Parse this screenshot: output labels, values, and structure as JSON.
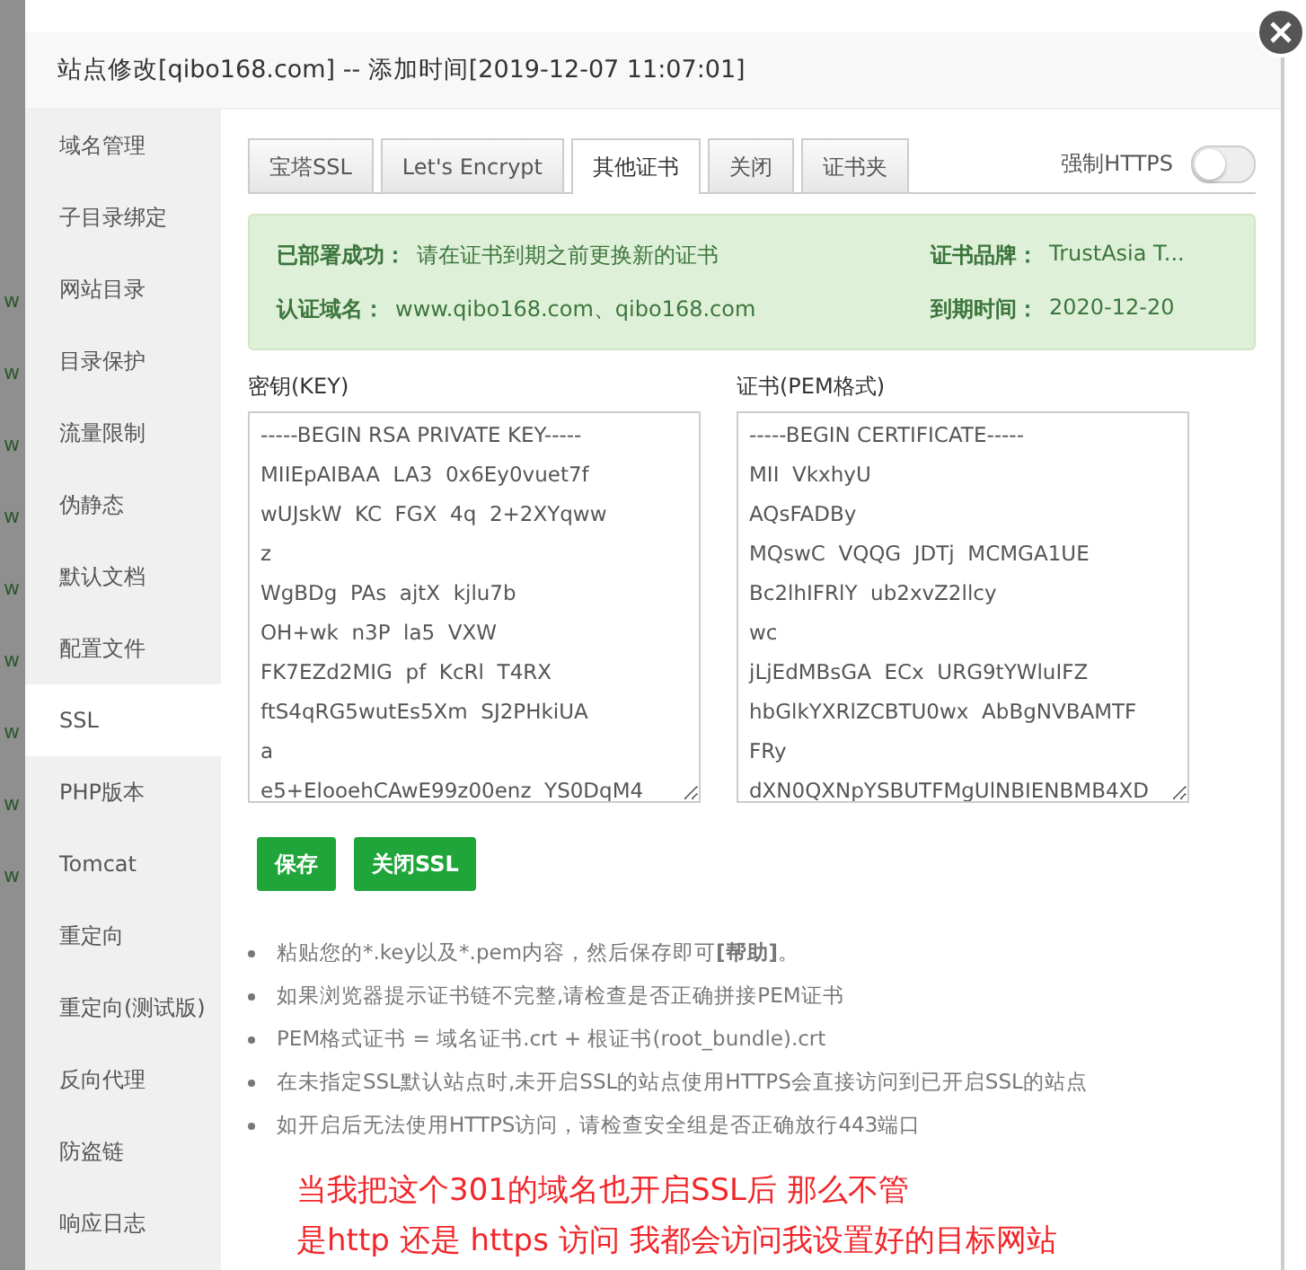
{
  "background_rows": [
    "w",
    "w",
    "w",
    "w",
    "w",
    "w",
    "w",
    "w",
    "w"
  ],
  "dialog": {
    "title": "站点修改[qibo168.com] -- 添加时间[2019-12-07 11:07:01]"
  },
  "sidebar": {
    "items": [
      {
        "label": "域名管理",
        "selected": false
      },
      {
        "label": "子目录绑定",
        "selected": false
      },
      {
        "label": "网站目录",
        "selected": false
      },
      {
        "label": "目录保护",
        "selected": false
      },
      {
        "label": "流量限制",
        "selected": false
      },
      {
        "label": "伪静态",
        "selected": false
      },
      {
        "label": "默认文档",
        "selected": false
      },
      {
        "label": "配置文件",
        "selected": false
      },
      {
        "label": "SSL",
        "selected": true
      },
      {
        "label": "PHP版本",
        "selected": false
      },
      {
        "label": "Tomcat",
        "selected": false
      },
      {
        "label": "重定向",
        "selected": false
      },
      {
        "label": "重定向(测试版)",
        "selected": false
      },
      {
        "label": "反向代理",
        "selected": false
      },
      {
        "label": "防盗链",
        "selected": false
      },
      {
        "label": "响应日志",
        "selected": false
      }
    ]
  },
  "tabs": [
    {
      "label": "宝塔SSL",
      "selected": false
    },
    {
      "label": "Let's Encrypt",
      "selected": false
    },
    {
      "label": "其他证书",
      "selected": true
    },
    {
      "label": "关闭",
      "selected": false
    },
    {
      "label": "证书夹",
      "selected": false
    }
  ],
  "force_https": {
    "label": "强制HTTPS",
    "on": false
  },
  "status": {
    "deployed_label": "已部署成功：",
    "deployed_text": "请在证书到期之前更换新的证书",
    "domains_label": "认证域名：",
    "domains": "www.qibo168.com、qibo168.com",
    "brand_label": "证书品牌：",
    "brand": "TrustAsia T...",
    "expiry_label": "到期时间：",
    "expiry": "2020-12-20"
  },
  "key_field": {
    "label": "密钥(KEY)",
    "lines": [
      "-----BEGIN RSA PRIVATE KEY-----",
      "MIIEpAIBAA  LA3  0x6Ey0vuet7f",
      "wUJskW  KC  FGX  4q  2+2XYqww",
      "z",
      "WgBDg  PAs  ajtX  kjlu7b",
      "OH+wk  n3P  la5  VXW",
      "FK7EZd2MIG  pf  KcRl  T4RX",
      "ftS4qRG5wutEs5Xm  SJ2PHkiUA",
      "a",
      "e5+ElooehCAwE99z00enz  YS0DqM4"
    ]
  },
  "cert_field": {
    "label": "证书(PEM格式)",
    "lines": [
      "-----BEGIN CERTIFICATE-----",
      "MII  VkxhyU",
      "AQsFADBy",
      "MQswC  VQQG  JDTj  MCMGA1UE",
      "Bc2lhIFRlY  ub2xvZ2llcy",
      "wc",
      "jLjEdMBsGA  ECx  URG9tYWluIFZ",
      "hbGlkYXRlZCBTU0wx  AbBgNVBAMTF",
      "FRy",
      "dXN0QXNpYSBUTFMgUlNBIENBMB4XD"
    ]
  },
  "buttons": [
    "保存",
    "关闭SSL"
  ],
  "notes": [
    "粘贴您的*.key以及*.pem内容，然后保存即可**[帮助]**。",
    "如果浏览器提示证书链不完整,请检查是否正确拼接PEM证书",
    "PEM格式证书 = 域名证书.crt + 根证书(root_bundle).crt",
    "在未指定SSL默认站点时,未开启SSL的站点使用HTTPS会直接访问到已开启SSL的站点",
    "如开启后无法使用HTTPS访问，请检查安全组是否正确放行443端口"
  ],
  "annotation": [
    "当我把这个301的域名也开启SSL后 那么不管",
    "是http 还是 https 访问 我都会访问我设置好的目标网站"
  ]
}
